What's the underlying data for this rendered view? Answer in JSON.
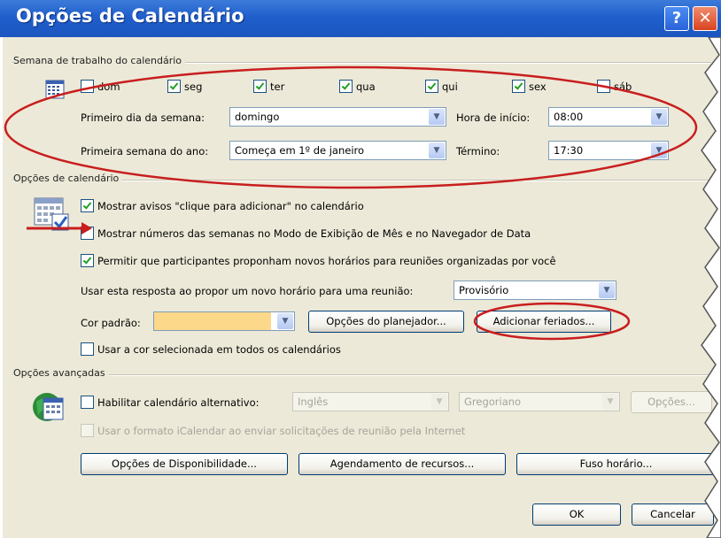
{
  "window": {
    "title": "Opções de Calendário",
    "help_label": "?",
    "close_label": "✕"
  },
  "work_week": {
    "group_label": "Semana de trabalho do calendário",
    "days": [
      {
        "label": "dom",
        "checked": false
      },
      {
        "label": "seg",
        "checked": true
      },
      {
        "label": "ter",
        "checked": true
      },
      {
        "label": "qua",
        "checked": true
      },
      {
        "label": "qui",
        "checked": true
      },
      {
        "label": "sex",
        "checked": true
      },
      {
        "label": "sáb",
        "checked": false
      }
    ],
    "first_day_label": "Primeiro dia da semana:",
    "first_day_value": "domingo",
    "first_week_label": "Primeira semana do ano:",
    "first_week_value": "Começa em 1º de janeiro",
    "start_time_label": "Hora de início:",
    "start_time_value": "08:00",
    "end_time_label": "Término:",
    "end_time_value": "17:30"
  },
  "calendar_options": {
    "group_label": "Opções de calendário",
    "show_click_to_add": {
      "label": "Mostrar avisos \"clique para adicionar\" no calendário",
      "checked": true
    },
    "show_week_numbers": {
      "label": "Mostrar números das semanas no Modo de Exibição de Mês e no Navegador de Data",
      "checked": false
    },
    "allow_propose": {
      "label": "Permitir que participantes proponham novos horários para reuniões organizadas por você",
      "checked": true
    },
    "response_label": "Usar esta resposta ao propor um novo horário para uma reunião:",
    "response_value": "Provisório",
    "default_color_label": "Cor padrão:",
    "default_color": "#fcd88a",
    "planner_button": "Opções do planejador...",
    "holidays_button": "Adicionar feriados...",
    "use_color_all": {
      "label": "Usar a cor selecionada em todos os calendários",
      "checked": false
    }
  },
  "advanced_options": {
    "group_label": "Opções avançadas",
    "alt_calendar": {
      "label": "Habilitar calendário alternativo:",
      "checked": false
    },
    "language_value": "Inglês",
    "calendar_type_value": "Gregoriano",
    "options_button": "Opções...",
    "icalendar": {
      "label": "Usar o formato iCalendar ao enviar solicitações de reunião pela Internet",
      "checked": false
    },
    "availability_button": "Opções de Disponibilidade...",
    "resources_button": "Agendamento de recursos...",
    "timezone_button": "Fuso horário..."
  },
  "footer": {
    "ok": "OK",
    "cancel": "Cancelar"
  },
  "annotations": {
    "ellipse_color": "#c81e1e",
    "arrow_color": "#c81e1e"
  },
  "icons": [
    "calendar-grid-icon",
    "calendar-check-icon",
    "globe-calendar-icon",
    "close-icon",
    "help-icon"
  ]
}
